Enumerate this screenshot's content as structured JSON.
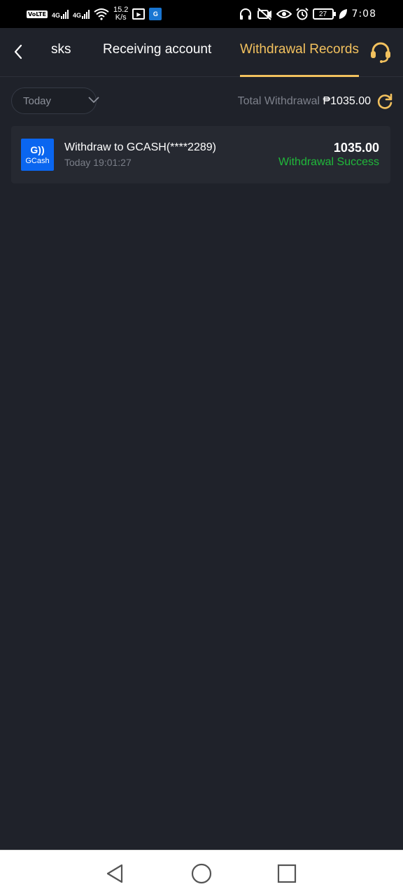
{
  "status_bar": {
    "volte": "VoLTE",
    "sim1_net": "4G",
    "sim2_net": "4G",
    "speed_value": "15.2",
    "speed_unit": "K/s",
    "battery": "27",
    "time": "7:08",
    "icons": [
      "headphones-icon",
      "camera-off-icon",
      "eye-icon",
      "alarm-icon",
      "leaf-icon"
    ]
  },
  "header": {
    "tabs": [
      {
        "label": "sks",
        "active": false
      },
      {
        "label": "Receiving account",
        "active": false
      },
      {
        "label": "Withdrawal Records",
        "active": true
      }
    ],
    "accent_color": "#f2c15e"
  },
  "filter": {
    "date_selected": "Today",
    "total_label": "Total Withdrawal",
    "total_amount": "₱1035.00"
  },
  "records": [
    {
      "logo_text": "GCash",
      "title": "Withdraw to GCASH(****2289)",
      "time": "Today 19:01:27",
      "amount": "1035.00",
      "status": "Withdrawal Success",
      "status_color": "#20b83a"
    }
  ]
}
